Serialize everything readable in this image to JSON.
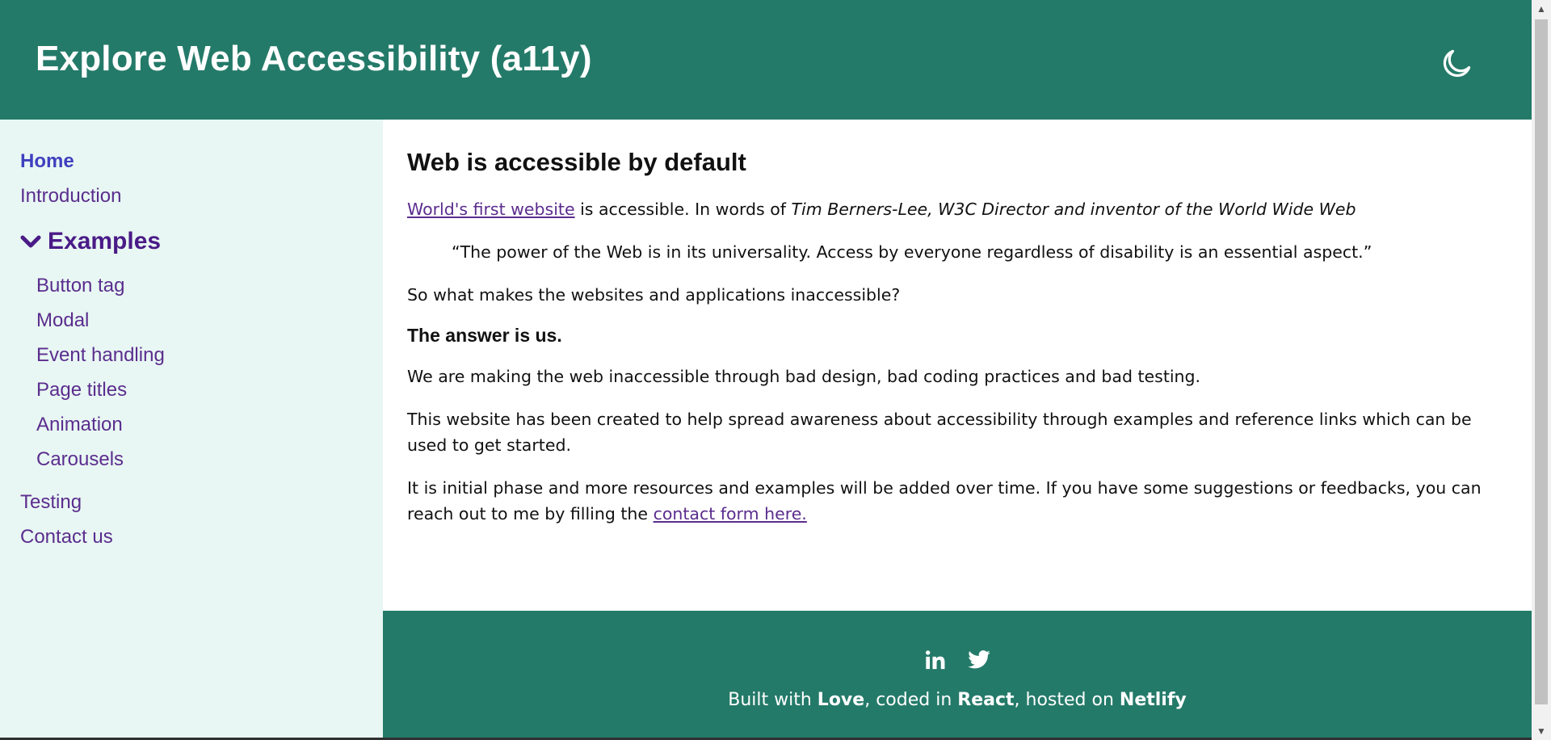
{
  "header": {
    "title": "Explore Web Accessibility (a11y)",
    "theme_toggle_icon": "moon-icon"
  },
  "sidebar": {
    "top_items": [
      {
        "label": "Home",
        "active": true
      },
      {
        "label": "Introduction",
        "active": false
      }
    ],
    "section": {
      "label": "Examples",
      "icon": "chevron-down-icon",
      "expanded": true,
      "items": [
        {
          "label": "Button tag"
        },
        {
          "label": "Modal"
        },
        {
          "label": "Event handling"
        },
        {
          "label": "Page titles"
        },
        {
          "label": "Animation"
        },
        {
          "label": "Carousels"
        }
      ]
    },
    "bottom_items": [
      {
        "label": "Testing"
      },
      {
        "label": "Contact us"
      }
    ]
  },
  "main": {
    "heading": "Web is accessible by default",
    "intro": {
      "link_text": "World's first website",
      "text_after_link": " is accessible. In words of ",
      "attribution": "Tim Berners-Lee, W3C Director and inventor of the World Wide Web"
    },
    "quote": "“The power of the Web is in its universality. Access by everyone regardless of disability is an essential aspect.”",
    "question": "So what makes the websites and applications inaccessible?",
    "subheading": "The answer is us.",
    "paragraph1": "We are making the web inaccessible through bad design, bad coding practices and bad testing.",
    "paragraph2": "This website has been created to help spread awareness about accessibility through examples and reference links which can be used to get started.",
    "paragraph3": {
      "text": "It is initial phase and more resources and examples will be added over time. If you have some suggestions or feedbacks, you can reach out to me by filling the ",
      "link_text": "contact form here."
    }
  },
  "footer": {
    "social": [
      {
        "icon": "linkedin-icon"
      },
      {
        "icon": "twitter-icon"
      }
    ],
    "text": {
      "part1": "Built with ",
      "love": "Love",
      "part2": ", coded in ",
      "react": "React",
      "part3": ", hosted on ",
      "netlify": "Netlify"
    }
  },
  "colors": {
    "brand": "#247a69",
    "sidebar_bg": "#e8f7f3",
    "link": "#5b2d8e",
    "active_link": "#3f3fbf"
  }
}
